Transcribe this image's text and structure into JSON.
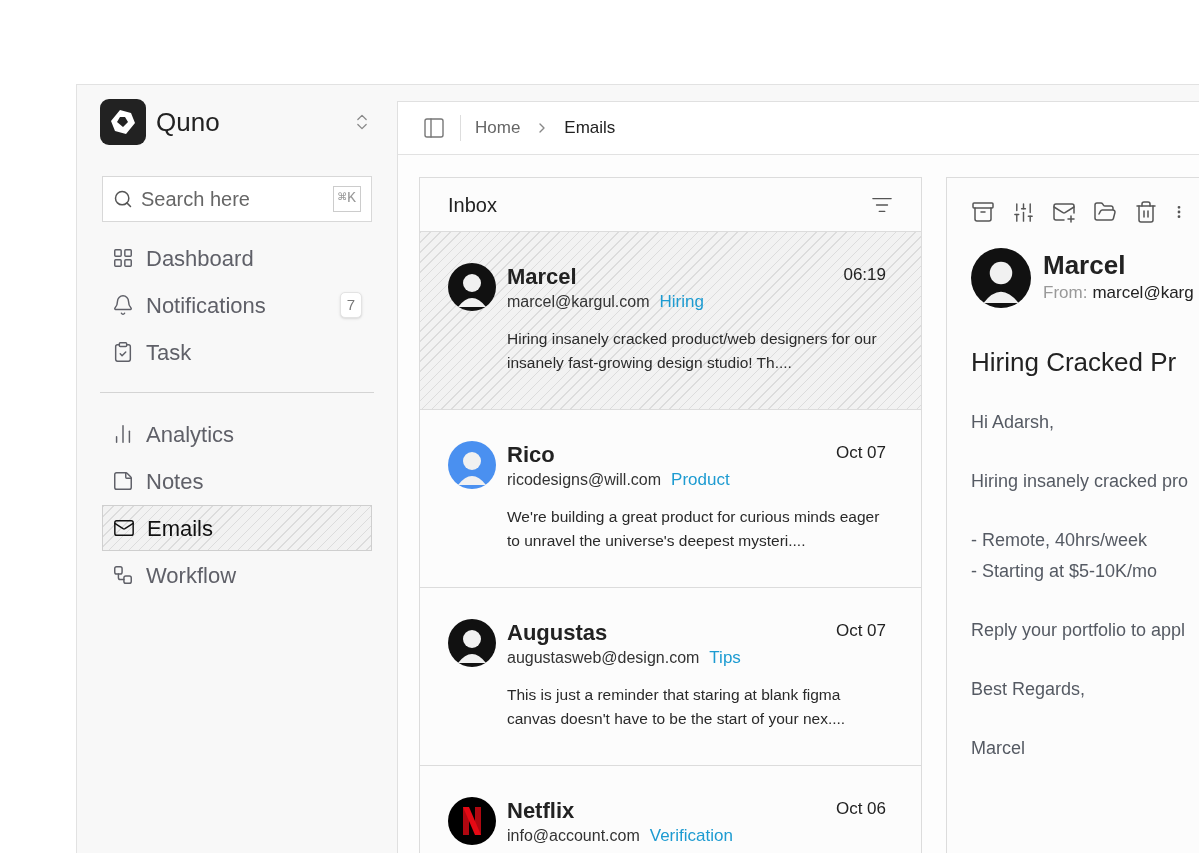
{
  "brand": {
    "name": "Quno"
  },
  "search": {
    "placeholder": "Search here",
    "shortcut": "⌘K"
  },
  "nav_groups": [
    [
      {
        "label": "Dashboard",
        "kind": "dashboard",
        "selected": false
      },
      {
        "label": "Notifications",
        "kind": "bell",
        "selected": false,
        "badge": "7"
      },
      {
        "label": "Task",
        "kind": "task",
        "selected": false
      }
    ],
    [
      {
        "label": "Analytics",
        "kind": "analytics",
        "selected": false
      },
      {
        "label": "Notes",
        "kind": "notes",
        "selected": false
      },
      {
        "label": "Emails",
        "kind": "mail",
        "selected": true
      },
      {
        "label": "Workflow",
        "kind": "workflow",
        "selected": false
      }
    ]
  ],
  "breadcrumb": [
    "Home",
    "Emails"
  ],
  "inbox": {
    "title": "Inbox",
    "emails": [
      {
        "name": "Marcel",
        "email": "marcel@kargul.com",
        "tag": "Hiring",
        "time": "06:19",
        "preview": "Hiring insanely cracked product/web designers for our insanely fast-growing design studio! Th....",
        "selected": true,
        "kind": "figure",
        "color": "#111111"
      },
      {
        "name": "Rico",
        "email": "ricodesigns@will.com",
        "tag": "Product",
        "time": "Oct 07",
        "preview": "We're building a great product for curious minds eager to unravel the universe's deepest mysteri....",
        "selected": false,
        "kind": "figure",
        "color": "#4a90f0"
      },
      {
        "name": "Augustas",
        "email": "augustasweb@design.com",
        "tag": "Tips",
        "time": "Oct 07",
        "preview": "This is just a reminder that staring at blank figma canvas doesn't have to be the start of your nex....",
        "selected": false,
        "kind": "figure",
        "color": "#111111"
      },
      {
        "name": "Netflix",
        "email": "info@account.com",
        "tag": "Verification",
        "time": "Oct 06",
        "selected": false,
        "kind": "logo",
        "color": "#000000"
      }
    ]
  },
  "message": {
    "sender": "Marcel",
    "from_label": "From:",
    "from": "marcel@karg",
    "subject": "Hiring Cracked Pr",
    "paragraphs": [
      [
        "Hi Adarsh,"
      ],
      [
        "Hiring insanely cracked pro"
      ],
      [
        "- Remote, 40hrs/week",
        "- Starting at $5-10K/mo"
      ],
      [
        "Reply your portfolio to appl"
      ],
      [
        "Best Regards,"
      ],
      [
        "Marcel"
      ]
    ]
  }
}
